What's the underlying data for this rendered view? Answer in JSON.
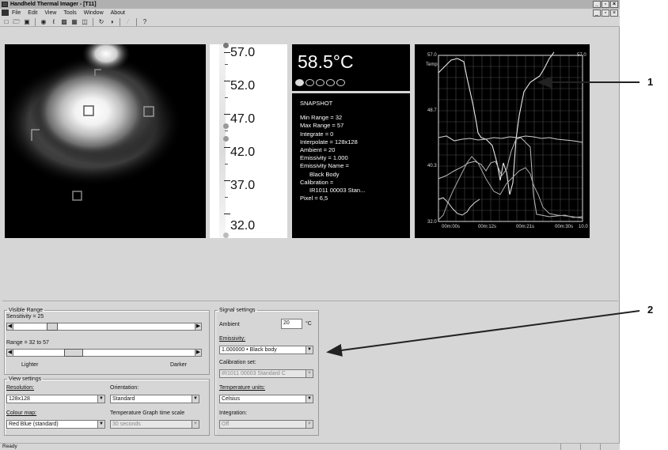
{
  "window": {
    "title": "Handheld Thermal Imager - [T11]",
    "min": "_",
    "max": "▫",
    "close": "×"
  },
  "menu": [
    "File",
    "Edit",
    "View",
    "Tools",
    "Window",
    "About"
  ],
  "toolbar_icons": [
    "new-icon",
    "open-icon",
    "save-icon",
    "camera-icon",
    "pen-icon",
    "copy-icon",
    "image-icon",
    "layout-icon",
    "refresh-icon",
    "contrast-icon",
    "disabled-icon",
    "help-icon"
  ],
  "scale": {
    "labels": [
      "57.0",
      "52.0",
      "47.0",
      "42.0",
      "37.0",
      "32.0"
    ]
  },
  "readout": {
    "temperature": "58.5°C"
  },
  "snapshot": {
    "title": "SNAPSHOT",
    "lines": [
      "Min Range = 32",
      "Max Range = 57",
      "Integrate = 0",
      "Interpolate = 128x128",
      "Ambient = 20",
      "Emissivity = 1.000",
      "Emissivity Name ="
    ],
    "emissivity_name": "Black Body",
    "calibration_label": "Calibration =",
    "calibration_value": "IR1011 00003 Stan...",
    "pixel": "Pixel = 6,5"
  },
  "graph": {
    "y_top": "57.0",
    "y_top_right": "57.0",
    "y_label": "Temp",
    "y_ticks": [
      "48.7",
      "40.3",
      "32.0"
    ],
    "x_ticks": [
      "00m:00s",
      "00m:12s",
      "00m:21s",
      "00m:30s"
    ],
    "x_end": "10.0"
  },
  "visible_range": {
    "legend": "Visible Range",
    "sensitivity_label": "Sensitivity = 25",
    "range_label": "Range = 32 to 57",
    "lighter": "Lighter",
    "darker": "Darker"
  },
  "view_settings": {
    "legend": "View settings",
    "resolution_label": "Resolution:",
    "resolution_value": "128x128",
    "orientation_label": "Orientation:",
    "orientation_value": "Standard",
    "colour_map_label": "Colour map:",
    "colour_map_value": "Red Blue (standard)",
    "graph_scale_label": "Temperature Graph time scale",
    "graph_scale_value": "30 seconds"
  },
  "signal_settings": {
    "legend": "Signal settings",
    "ambient_label": "Ambient",
    "ambient_value": "20",
    "ambient_unit": "°C",
    "emissivity_label": "Emissivity:",
    "emissivity_value": "1.000000 • Black body",
    "calibration_label": "Calibration set:",
    "calibration_value": "IR1011 00003 Standard C",
    "units_label": "Temperature units:",
    "units_value": "Celsius",
    "integration_label": "Integration:",
    "integration_value": "Off"
  },
  "status": {
    "text": "Ready"
  },
  "callouts": {
    "one": "1",
    "two": "2"
  }
}
